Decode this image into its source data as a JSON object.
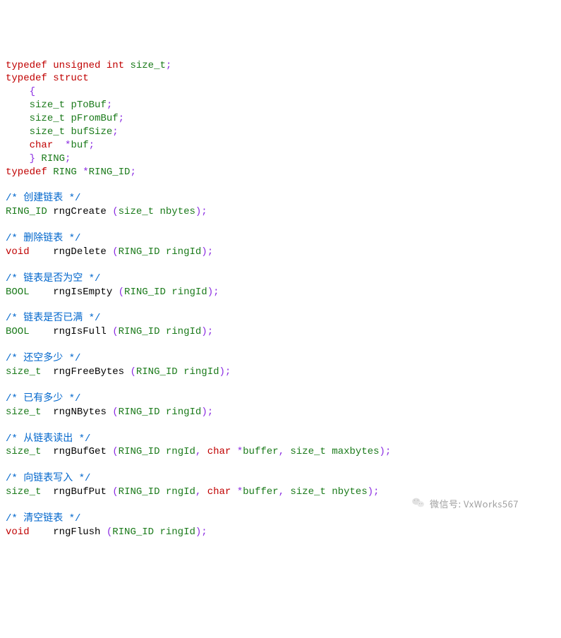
{
  "code": {
    "lines": [
      [
        {
          "c": "kw",
          "t": "typedef"
        },
        {
          "c": "",
          "t": " "
        },
        {
          "c": "kw",
          "t": "unsigned"
        },
        {
          "c": "",
          "t": " "
        },
        {
          "c": "kw",
          "t": "int"
        },
        {
          "c": "",
          "t": " "
        },
        {
          "c": "typ",
          "t": "size_t"
        },
        {
          "c": "pun",
          "t": ";"
        }
      ],
      [
        {
          "c": "kw",
          "t": "typedef"
        },
        {
          "c": "",
          "t": " "
        },
        {
          "c": "kw",
          "t": "struct"
        }
      ],
      [
        {
          "c": "",
          "t": "    "
        },
        {
          "c": "pun",
          "t": "{"
        }
      ],
      [
        {
          "c": "",
          "t": "    "
        },
        {
          "c": "typ",
          "t": "size_t"
        },
        {
          "c": "",
          "t": " "
        },
        {
          "c": "typ",
          "t": "pToBuf"
        },
        {
          "c": "pun",
          "t": ";"
        }
      ],
      [
        {
          "c": "",
          "t": "    "
        },
        {
          "c": "typ",
          "t": "size_t"
        },
        {
          "c": "",
          "t": " "
        },
        {
          "c": "typ",
          "t": "pFromBuf"
        },
        {
          "c": "pun",
          "t": ";"
        }
      ],
      [
        {
          "c": "",
          "t": "    "
        },
        {
          "c": "typ",
          "t": "size_t"
        },
        {
          "c": "",
          "t": " "
        },
        {
          "c": "typ",
          "t": "bufSize"
        },
        {
          "c": "pun",
          "t": ";"
        }
      ],
      [
        {
          "c": "",
          "t": "    "
        },
        {
          "c": "kw",
          "t": "char"
        },
        {
          "c": "",
          "t": "  "
        },
        {
          "c": "pun",
          "t": "*"
        },
        {
          "c": "typ",
          "t": "buf"
        },
        {
          "c": "pun",
          "t": ";"
        }
      ],
      [
        {
          "c": "",
          "t": "    "
        },
        {
          "c": "pun",
          "t": "}"
        },
        {
          "c": "",
          "t": " "
        },
        {
          "c": "typ",
          "t": "RING"
        },
        {
          "c": "pun",
          "t": ";"
        }
      ],
      [
        {
          "c": "kw",
          "t": "typedef"
        },
        {
          "c": "",
          "t": " "
        },
        {
          "c": "typ",
          "t": "RING"
        },
        {
          "c": "",
          "t": " "
        },
        {
          "c": "pun",
          "t": "*"
        },
        {
          "c": "typ",
          "t": "RING_ID"
        },
        {
          "c": "pun",
          "t": ";"
        }
      ],
      [],
      [
        {
          "c": "cmt",
          "t": "/* 创建链表 */"
        }
      ],
      [
        {
          "c": "typ",
          "t": "RING_ID"
        },
        {
          "c": "",
          "t": " "
        },
        {
          "c": "nam",
          "t": "rngCreate"
        },
        {
          "c": "",
          "t": " "
        },
        {
          "c": "pun",
          "t": "("
        },
        {
          "c": "typ",
          "t": "size_t"
        },
        {
          "c": "",
          "t": " "
        },
        {
          "c": "typ",
          "t": "nbytes"
        },
        {
          "c": "pun",
          "t": ");"
        }
      ],
      [],
      [
        {
          "c": "cmt",
          "t": "/* 删除链表 */"
        }
      ],
      [
        {
          "c": "kw",
          "t": "void"
        },
        {
          "c": "",
          "t": "    "
        },
        {
          "c": "nam",
          "t": "rngDelete"
        },
        {
          "c": "",
          "t": " "
        },
        {
          "c": "pun",
          "t": "("
        },
        {
          "c": "typ",
          "t": "RING_ID"
        },
        {
          "c": "",
          "t": " "
        },
        {
          "c": "typ",
          "t": "ringId"
        },
        {
          "c": "pun",
          "t": ");"
        }
      ],
      [],
      [
        {
          "c": "cmt",
          "t": "/* 链表是否为空 */"
        }
      ],
      [
        {
          "c": "typ",
          "t": "BOOL"
        },
        {
          "c": "",
          "t": "    "
        },
        {
          "c": "nam",
          "t": "rngIsEmpty"
        },
        {
          "c": "",
          "t": " "
        },
        {
          "c": "pun",
          "t": "("
        },
        {
          "c": "typ",
          "t": "RING_ID"
        },
        {
          "c": "",
          "t": " "
        },
        {
          "c": "typ",
          "t": "ringId"
        },
        {
          "c": "pun",
          "t": ");"
        }
      ],
      [],
      [
        {
          "c": "cmt",
          "t": "/* 链表是否已满 */"
        }
      ],
      [
        {
          "c": "typ",
          "t": "BOOL"
        },
        {
          "c": "",
          "t": "    "
        },
        {
          "c": "nam",
          "t": "rngIsFull"
        },
        {
          "c": "",
          "t": " "
        },
        {
          "c": "pun",
          "t": "("
        },
        {
          "c": "typ",
          "t": "RING_ID"
        },
        {
          "c": "",
          "t": " "
        },
        {
          "c": "typ",
          "t": "ringId"
        },
        {
          "c": "pun",
          "t": ");"
        }
      ],
      [],
      [
        {
          "c": "cmt",
          "t": "/* 还空多少 */"
        }
      ],
      [
        {
          "c": "typ",
          "t": "size_t"
        },
        {
          "c": "",
          "t": "  "
        },
        {
          "c": "nam",
          "t": "rngFreeBytes"
        },
        {
          "c": "",
          "t": " "
        },
        {
          "c": "pun",
          "t": "("
        },
        {
          "c": "typ",
          "t": "RING_ID"
        },
        {
          "c": "",
          "t": " "
        },
        {
          "c": "typ",
          "t": "ringId"
        },
        {
          "c": "pun",
          "t": ");"
        }
      ],
      [],
      [
        {
          "c": "cmt",
          "t": "/* 已有多少 */"
        }
      ],
      [
        {
          "c": "typ",
          "t": "size_t"
        },
        {
          "c": "",
          "t": "  "
        },
        {
          "c": "nam",
          "t": "rngNBytes"
        },
        {
          "c": "",
          "t": " "
        },
        {
          "c": "pun",
          "t": "("
        },
        {
          "c": "typ",
          "t": "RING_ID"
        },
        {
          "c": "",
          "t": " "
        },
        {
          "c": "typ",
          "t": "ringId"
        },
        {
          "c": "pun",
          "t": ");"
        }
      ],
      [],
      [
        {
          "c": "cmt",
          "t": "/* 从链表读出 */"
        }
      ],
      [
        {
          "c": "typ",
          "t": "size_t"
        },
        {
          "c": "",
          "t": "  "
        },
        {
          "c": "nam",
          "t": "rngBufGet"
        },
        {
          "c": "",
          "t": " "
        },
        {
          "c": "pun",
          "t": "("
        },
        {
          "c": "typ",
          "t": "RING_ID"
        },
        {
          "c": "",
          "t": " "
        },
        {
          "c": "typ",
          "t": "rngId"
        },
        {
          "c": "pun",
          "t": ","
        },
        {
          "c": "",
          "t": " "
        },
        {
          "c": "kw",
          "t": "char"
        },
        {
          "c": "",
          "t": " "
        },
        {
          "c": "pun",
          "t": "*"
        },
        {
          "c": "typ",
          "t": "buffer"
        },
        {
          "c": "pun",
          "t": ","
        },
        {
          "c": "",
          "t": " "
        },
        {
          "c": "typ",
          "t": "size_t"
        },
        {
          "c": "",
          "t": " "
        },
        {
          "c": "typ",
          "t": "maxbytes"
        },
        {
          "c": "pun",
          "t": ");"
        }
      ],
      [],
      [
        {
          "c": "cmt",
          "t": "/* 向链表写入 */"
        }
      ],
      [
        {
          "c": "typ",
          "t": "size_t"
        },
        {
          "c": "",
          "t": "  "
        },
        {
          "c": "nam",
          "t": "rngBufPut"
        },
        {
          "c": "",
          "t": " "
        },
        {
          "c": "pun",
          "t": "("
        },
        {
          "c": "typ",
          "t": "RING_ID"
        },
        {
          "c": "",
          "t": " "
        },
        {
          "c": "typ",
          "t": "rngId"
        },
        {
          "c": "pun",
          "t": ","
        },
        {
          "c": "",
          "t": " "
        },
        {
          "c": "kw",
          "t": "char"
        },
        {
          "c": "",
          "t": " "
        },
        {
          "c": "pun",
          "t": "*"
        },
        {
          "c": "typ",
          "t": "buffer"
        },
        {
          "c": "pun",
          "t": ","
        },
        {
          "c": "",
          "t": " "
        },
        {
          "c": "typ",
          "t": "size_t"
        },
        {
          "c": "",
          "t": " "
        },
        {
          "c": "typ",
          "t": "nbytes"
        },
        {
          "c": "pun",
          "t": ");"
        }
      ],
      [],
      [
        {
          "c": "cmt",
          "t": "/* 清空链表 */"
        }
      ],
      [
        {
          "c": "kw",
          "t": "void"
        },
        {
          "c": "",
          "t": "    "
        },
        {
          "c": "nam",
          "t": "rngFlush"
        },
        {
          "c": "",
          "t": " "
        },
        {
          "c": "pun",
          "t": "("
        },
        {
          "c": "typ",
          "t": "RING_ID"
        },
        {
          "c": "",
          "t": " "
        },
        {
          "c": "typ",
          "t": "ringId"
        },
        {
          "c": "pun",
          "t": ");"
        }
      ]
    ]
  },
  "watermark": {
    "label": "微信号: VxWorks567"
  }
}
